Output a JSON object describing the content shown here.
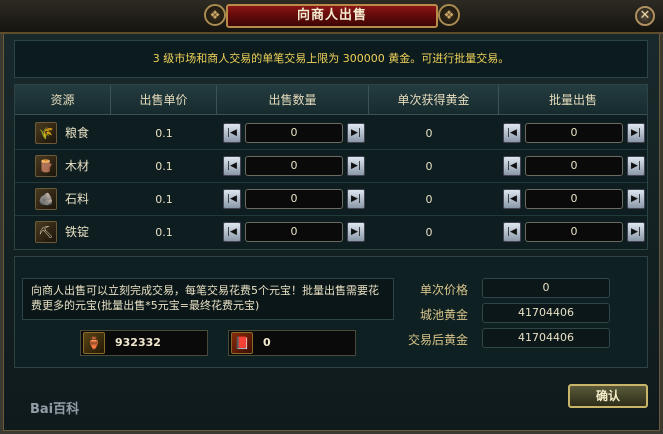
{
  "window": {
    "title": "向商人出售",
    "close_glyph": "✕"
  },
  "notice": "3 级市场和商人交易的单笔交易上限为 300000 黄金。可进行批量交易。",
  "table": {
    "headers": [
      "资源",
      "出售单价",
      "出售数量",
      "单次获得黄金",
      "批量出售"
    ],
    "rows": [
      {
        "icon": "grain-icon",
        "glyph": "🌾",
        "name": "粮食",
        "price": "0.1",
        "qty": "0",
        "gold": "0",
        "batch": "0"
      },
      {
        "icon": "wood-icon",
        "glyph": "🪵",
        "name": "木材",
        "price": "0.1",
        "qty": "0",
        "gold": "0",
        "batch": "0"
      },
      {
        "icon": "stone-icon",
        "glyph": "🪨",
        "name": "石料",
        "price": "0.1",
        "qty": "0",
        "gold": "0",
        "batch": "0"
      },
      {
        "icon": "iron-ingot-icon",
        "glyph": "⛏",
        "name": "铁锭",
        "price": "0.1",
        "qty": "0",
        "gold": "0",
        "batch": "0"
      }
    ],
    "step_min_glyph": "|◀",
    "step_max_glyph": "▶|"
  },
  "info": "向商人出售可以立刻完成交易，每笔交易花费5个元宝！批量出售需要花费更多的元宝(批量出售*5元宝=最终花费元宝)",
  "balances": {
    "gold_glyph": "🏺",
    "gold": "932332",
    "ingot_glyph": "📕",
    "ingot": "0"
  },
  "summary": [
    {
      "label": "单次价格",
      "value": "0"
    },
    {
      "label": "城池黄金",
      "value": "41704406"
    },
    {
      "label": "交易后黄金",
      "value": "41704406"
    }
  ],
  "confirm_label": "确认",
  "watermark": "Bai百科"
}
